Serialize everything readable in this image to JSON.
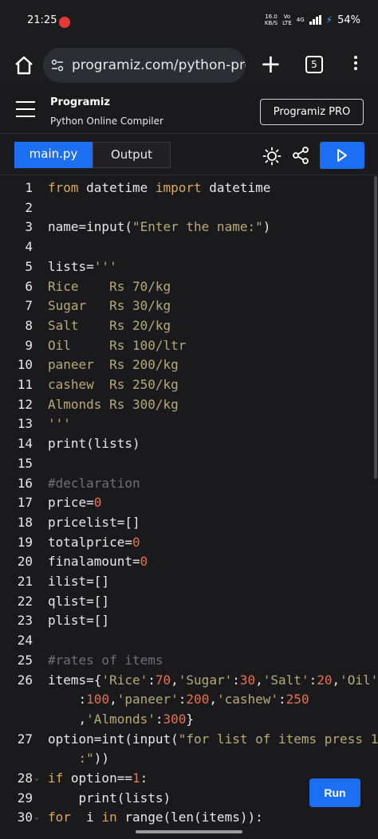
{
  "status_bar": {
    "time": "21:25",
    "speed": "16.0\nKB/S",
    "network": "Vo\nLTE",
    "net_gen": "4G",
    "battery": "54%"
  },
  "browser": {
    "url": "programiz.com/python-programm",
    "tab_count": "5"
  },
  "site": {
    "logo": "Programiz",
    "subtitle": "Python Online Compiler",
    "pro_button": "Programiz PRO"
  },
  "tabs": {
    "main": "main.py",
    "output": "Output"
  },
  "run_button": "Run",
  "code_lines": [
    {
      "no": "1",
      "fold": "",
      "html": "<span class=\"k\">from</span> datetime <span class=\"k\">import</span> datetime"
    },
    {
      "no": "2",
      "fold": "",
      "html": ""
    },
    {
      "no": "3",
      "fold": "",
      "html": "name=input(<span class=\"s\">\"Enter the name:\"</span>)"
    },
    {
      "no": "4",
      "fold": "",
      "html": ""
    },
    {
      "no": "5",
      "fold": "",
      "html": "lists=<span class=\"s\">'''</span>"
    },
    {
      "no": "6",
      "fold": "",
      "html": "<span class=\"s\">Rice    Rs 70/kg</span>"
    },
    {
      "no": "7",
      "fold": "",
      "html": "<span class=\"s\">Sugar   Rs 30/kg</span>"
    },
    {
      "no": "8",
      "fold": "",
      "html": "<span class=\"s\">Salt    Rs 20/kg</span>"
    },
    {
      "no": "9",
      "fold": "",
      "html": "<span class=\"s\">Oil     Rs 100/ltr</span>"
    },
    {
      "no": "10",
      "fold": "",
      "html": "<span class=\"s\">paneer  Rs 200/kg</span>"
    },
    {
      "no": "11",
      "fold": "",
      "html": "<span class=\"s\">cashew  Rs 250/kg</span>"
    },
    {
      "no": "12",
      "fold": "",
      "html": "<span class=\"s\">Almonds Rs 300/kg</span>"
    },
    {
      "no": "13",
      "fold": "",
      "html": "<span class=\"s\">'''</span>"
    },
    {
      "no": "14",
      "fold": "",
      "html": "print(lists)"
    },
    {
      "no": "15",
      "fold": "",
      "html": ""
    },
    {
      "no": "16",
      "fold": "",
      "html": "<span class=\"c\">#declaration</span>"
    },
    {
      "no": "17",
      "fold": "",
      "html": "price=<span class=\"n\">0</span>"
    },
    {
      "no": "18",
      "fold": "",
      "html": "pricelist=[]"
    },
    {
      "no": "19",
      "fold": "",
      "html": "totalprice=<span class=\"n\">0</span>"
    },
    {
      "no": "20",
      "fold": "",
      "html": "finalamount=<span class=\"n\">0</span>"
    },
    {
      "no": "21",
      "fold": "",
      "html": "ilist=[]"
    },
    {
      "no": "22",
      "fold": "",
      "html": "qlist=[]"
    },
    {
      "no": "23",
      "fold": "",
      "html": "plist=[]"
    },
    {
      "no": "24",
      "fold": "",
      "html": ""
    },
    {
      "no": "25",
      "fold": "",
      "html": "<span class=\"c\">#rates of items</span>"
    },
    {
      "no": "26",
      "fold": "",
      "html": "items={<span class=\"s\">'Rice'</span>:<span class=\"n\">70</span>,<span class=\"s\">'Sugar'</span>:<span class=\"n\">30</span>,<span class=\"s\">'Salt'</span>:<span class=\"n\">20</span>,<span class=\"s\">'Oil'</span>"
    },
    {
      "no": "",
      "fold": "",
      "html": "    :<span class=\"n\">100</span>,<span class=\"s\">'paneer'</span>:<span class=\"n\">200</span>,<span class=\"s\">'cashew'</span>:<span class=\"n\">250</span>"
    },
    {
      "no": "",
      "fold": "",
      "html": "    ,<span class=\"s\">'Almonds'</span>:<span class=\"n\">300</span>}"
    },
    {
      "no": "27",
      "fold": "",
      "html": "option=int(input(<span class=\"s\">\"for list of items press 1</span>"
    },
    {
      "no": "",
      "fold": "",
      "html": "    <span class=\"s\">:\"</span>))"
    },
    {
      "no": "28",
      "fold": "⌄",
      "html": "<span class=\"k\">if</span> option==<span class=\"n\">1</span>:"
    },
    {
      "no": "29",
      "fold": "",
      "html": "    print(lists)"
    },
    {
      "no": "30",
      "fold": "⌄",
      "html": "<span class=\"k\">for</span>  i <span class=\"k\">in</span> range(len(items)):"
    }
  ]
}
